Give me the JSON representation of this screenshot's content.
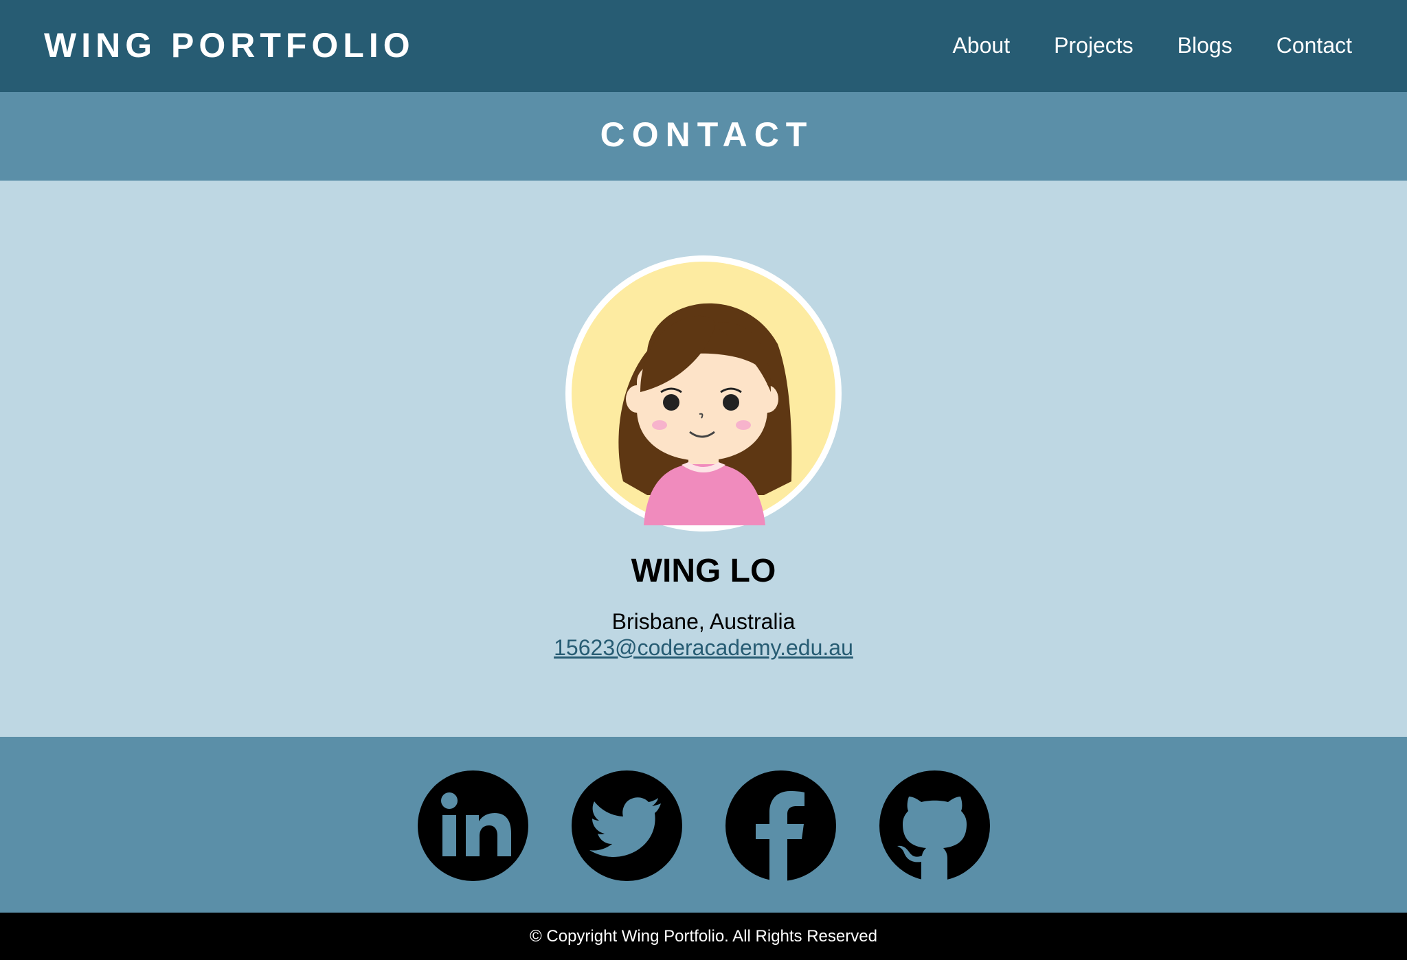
{
  "header": {
    "brand": "WING PORTFOLIO",
    "nav": [
      {
        "label": "About"
      },
      {
        "label": "Projects"
      },
      {
        "label": "Blogs"
      },
      {
        "label": "Contact"
      }
    ]
  },
  "page": {
    "title": "CONTACT"
  },
  "profile": {
    "avatar_icon": "girl-avatar-icon",
    "name": "WING LO",
    "location": "Brisbane, Australia",
    "email": "15623@coderacademy.edu.au"
  },
  "social": [
    {
      "icon": "linkedin-icon"
    },
    {
      "icon": "twitter-icon"
    },
    {
      "icon": "facebook-icon"
    },
    {
      "icon": "github-icon"
    }
  ],
  "footer": {
    "text": "© Copyright Wing Portfolio. All Rights Reserved"
  },
  "colors": {
    "nav_bg": "#275c73",
    "header_bg": "#5b8fa8",
    "content_bg": "#bed7e3",
    "footer_bg": "#000000",
    "link": "#275c73"
  }
}
